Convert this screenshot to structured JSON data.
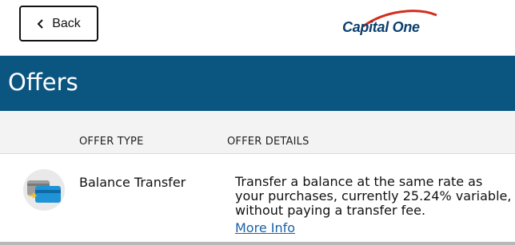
{
  "header": {
    "back_label": "Back",
    "logo_text": "Capital One",
    "brand_colors": {
      "navy": "#0b3f6e",
      "red": "#d22e1e"
    }
  },
  "banner": {
    "title": "Offers",
    "color": "#0b5581"
  },
  "table": {
    "columns": [
      "OFFER TYPE",
      "OFFER DETAILS"
    ],
    "rows": [
      {
        "icon": "credit-card-transfer-icon",
        "offer_type": "Balance Transfer",
        "details": "Transfer a balance at the same rate as your purchases, currently 25.24% variable, without paying a transfer fee.",
        "link": "More Info"
      }
    ]
  }
}
